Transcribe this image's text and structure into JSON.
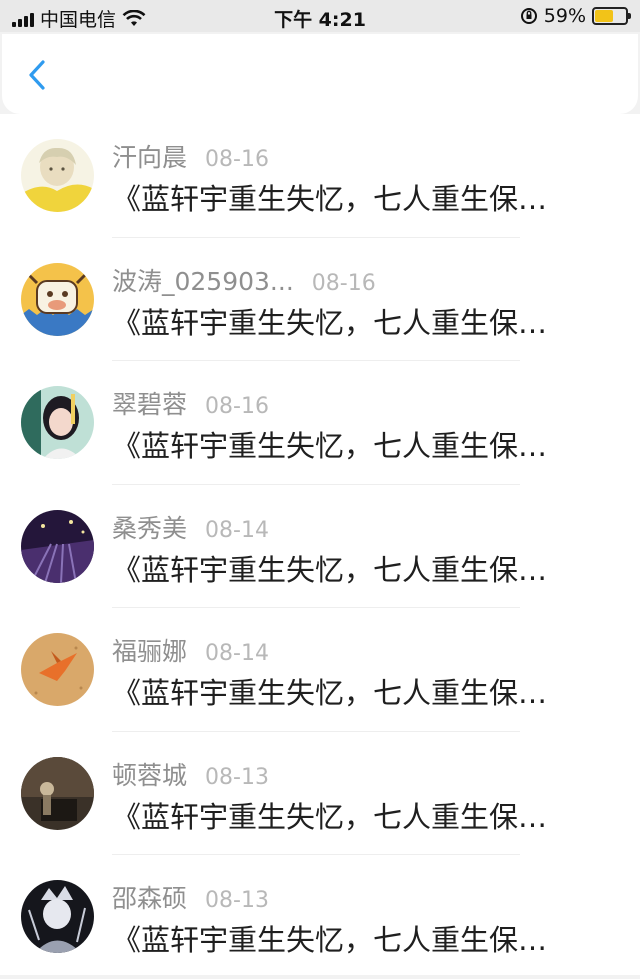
{
  "status_bar": {
    "carrier": "中国电信",
    "time": "下午 4:21",
    "battery_percent": "59%",
    "battery_level": 0.59
  },
  "nav": {
    "back_icon": "chevron-left-icon",
    "accent": "#2f9bef"
  },
  "messages": [
    {
      "name": "汗向晨",
      "date": "08-16",
      "text": "《蓝轩宇重生失忆，七人重生保…",
      "avatar": "anime-boy"
    },
    {
      "name": "波涛_025903...",
      "date": "08-16",
      "text": "《蓝轩宇重生失忆，七人重生保…",
      "avatar": "cartoon-cow"
    },
    {
      "name": "翠碧蓉",
      "date": "08-16",
      "text": "《蓝轩宇重生失忆，七人重生保…",
      "avatar": "girl-photo"
    },
    {
      "name": "桑秀美",
      "date": "08-14",
      "text": "《蓝轩宇重生失忆，七人重生保…",
      "avatar": "night-stage"
    },
    {
      "name": "福骊娜",
      "date": "08-14",
      "text": "《蓝轩宇重生失忆，七人重生保…",
      "avatar": "paper-crane"
    },
    {
      "name": "顿蓉城",
      "date": "08-13",
      "text": "《蓝轩宇重生失忆，七人重生保…",
      "avatar": "piano-dark"
    },
    {
      "name": "邵森硕",
      "date": "08-13",
      "text": "《蓝轩宇重生失忆，七人重生保…",
      "avatar": "anime-sketch"
    }
  ]
}
